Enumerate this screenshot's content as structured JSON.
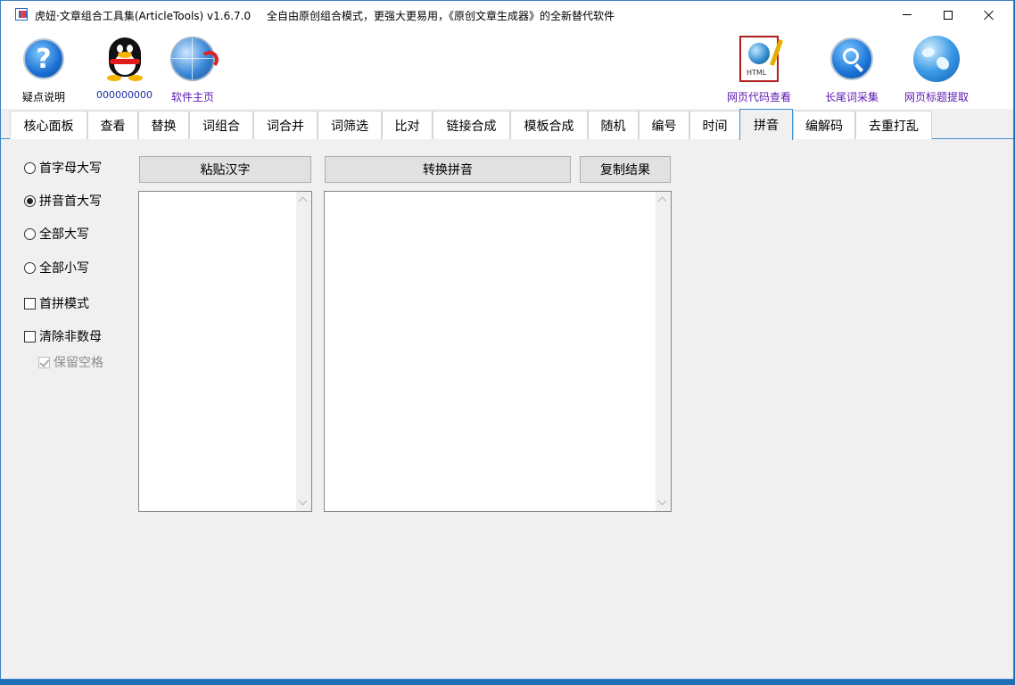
{
  "window": {
    "title": "虎妞·文章组合工具集(ArticleTools) v1.6.7.0",
    "slogan": "全自由原创组合模式，更强大更易用，《原创文章生成器》的全新替代软件"
  },
  "toolbar": {
    "left_tools": [
      {
        "label": "疑点说明",
        "icon": "help-icon"
      },
      {
        "label": "000000000",
        "icon": "qq-penguin-icon"
      },
      {
        "label": "软件主页",
        "icon": "globe-arrow-icon"
      }
    ],
    "right_tools": [
      {
        "label": "网页代码查看",
        "icon": "html-document-icon"
      },
      {
        "label": "长尾词采集",
        "icon": "search-icon"
      },
      {
        "label": "网页标题提取",
        "icon": "globe-icon"
      }
    ]
  },
  "tabs": [
    "核心面板",
    "查看",
    "替换",
    "词组合",
    "词合并",
    "词筛选",
    "比对",
    "链接合成",
    "模板合成",
    "随机",
    "编号",
    "时间",
    "拼音",
    "编解码",
    "去重打乱"
  ],
  "active_tab": "拼音",
  "options": {
    "radios": [
      {
        "label": "首字母大写",
        "checked": false
      },
      {
        "label": "拼音首大写",
        "checked": true
      },
      {
        "label": "全部大写",
        "checked": false
      },
      {
        "label": "全部小写",
        "checked": false
      }
    ],
    "checkboxes": [
      {
        "label": "首拼模式",
        "checked": false
      },
      {
        "label": "清除非数母",
        "checked": false
      },
      {
        "label": "保留空格",
        "checked": true,
        "disabled": true
      }
    ]
  },
  "buttons": {
    "paste": "粘贴汉字",
    "convert": "转换拼音",
    "copy": "复制结果"
  },
  "textareas": {
    "input_value": "",
    "output_value": ""
  }
}
